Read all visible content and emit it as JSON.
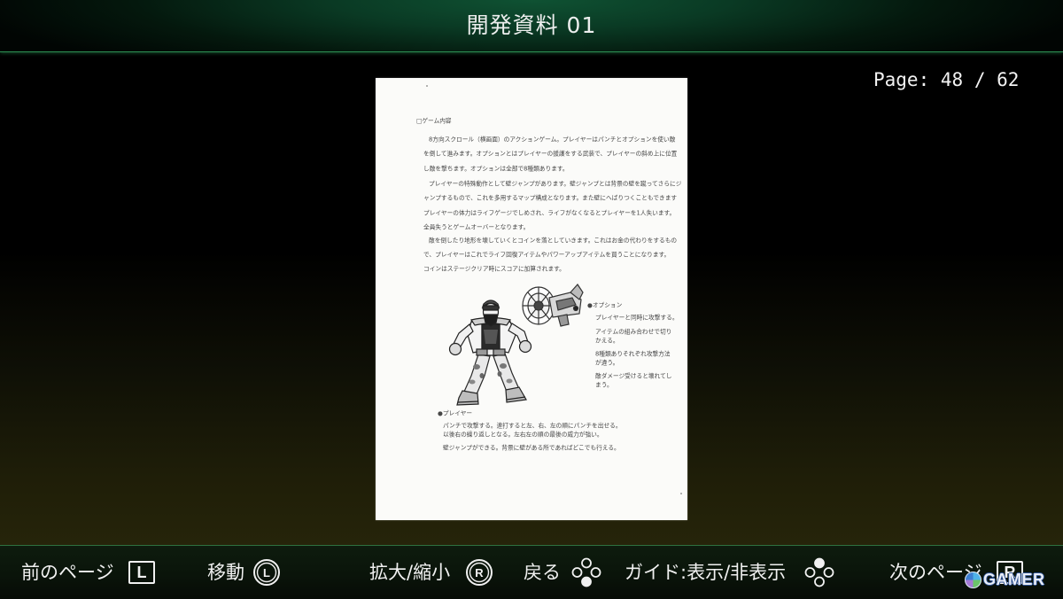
{
  "header": {
    "title": "開発資料 01"
  },
  "pager": {
    "label": "Page:",
    "current": "48",
    "separator": "/",
    "total": "62"
  },
  "document": {
    "heading": "□ゲーム内容",
    "paragraphs": [
      [
        "8方向スクロール（横画面）のアクションゲーム。プレイヤーはパンチとオプションを使い敵",
        "を倒して進みます。オプションとはプレイヤーの援護をする武装で、プレイヤーの斜め上に位置",
        "し敵を撃ちます。オプションは全部で8種類あります。"
      ],
      [
        "プレイヤーの特殊動作として壁ジャンプがあります。壁ジャンプとは背景の壁を蹴ってさらにジ",
        "ャンプするもので、これを多用するマップ構成となります。また壁にへばりつくこともできます",
        "プレイヤーの体力はライフゲージでしめされ、ライフがなくなるとプレイヤーを1人失います。",
        "全員失うとゲームオーバーとなります。"
      ],
      [
        "敵を倒したり地形を壊していくとコインを落としていきます。これはお金の代わりをするもの",
        "で、プレイヤーはこれでライフ回復アイテムやパワーアップアイテムを買うことになります。",
        "コインはステージクリア時にスコアに加算されます。"
      ]
    ],
    "option": {
      "title": "●オプション",
      "lines": [
        "プレイヤーと同時に攻撃する。",
        "アイテムの組み合わせで切り",
        "かえる。",
        "8種類ありそれぞれ攻撃方法",
        "が違う。",
        "敵ダメージ受けると壊れてし",
        "まう。"
      ]
    },
    "player": {
      "title": "●プレイヤー",
      "lines": [
        "パンチで攻撃する。連打すると左、右、左の順にパンチを出せる。",
        "以後右の繰り返しとなる。左右左の順の最後の威力が強い。",
        "壁ジャンプができる。背景に壁がある所であればどこでも行える。"
      ]
    }
  },
  "footer": {
    "prev": {
      "label": "前のページ",
      "key": "L",
      "icon": "l-button-icon"
    },
    "move": {
      "label": "移動",
      "key": "L",
      "icon": "left-stick-icon"
    },
    "zoom": {
      "label": "拡大/縮小",
      "key": "R",
      "icon": "right-stick-icon"
    },
    "back": {
      "label": "戻る",
      "icon": "face-buttons-b-icon"
    },
    "guide": {
      "label": "ガイド:表示/非表示",
      "icon": "face-buttons-x-icon"
    },
    "next": {
      "label": "次のページ",
      "key": "R",
      "icon": "r-button-icon"
    }
  },
  "watermark": {
    "text": "GAMER"
  },
  "colors": {
    "accent_line": "#2d8f53",
    "header_glow": "#0f5233",
    "paper": "#fbfbf9",
    "text": "#f1f1f1"
  }
}
